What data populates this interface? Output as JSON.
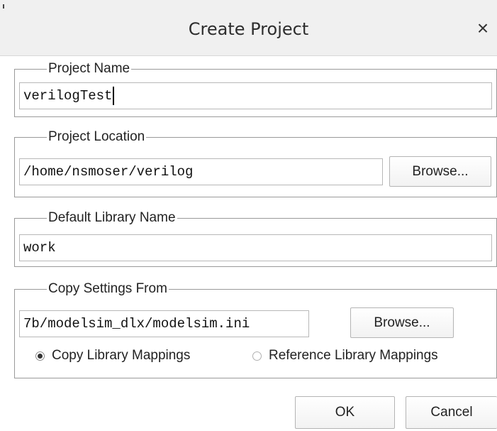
{
  "dialog": {
    "title": "Create Project",
    "close_glyph": "×"
  },
  "project_name": {
    "legend": "Project Name",
    "value": "verilogTest"
  },
  "project_location": {
    "legend": "Project Location",
    "value": "/home/nsmoser/verilog",
    "browse_label": "Browse..."
  },
  "default_library": {
    "legend": "Default Library Name",
    "value": "work"
  },
  "copy_settings": {
    "legend": "Copy Settings From",
    "value": "7b/modelsim_dlx/modelsim.ini",
    "browse_label": "Browse...",
    "options": [
      {
        "label": "Copy Library Mappings",
        "checked": true
      },
      {
        "label": "Reference Library Mappings",
        "checked": false
      }
    ]
  },
  "footer": {
    "ok_label": "OK",
    "cancel_label": "Cancel"
  }
}
